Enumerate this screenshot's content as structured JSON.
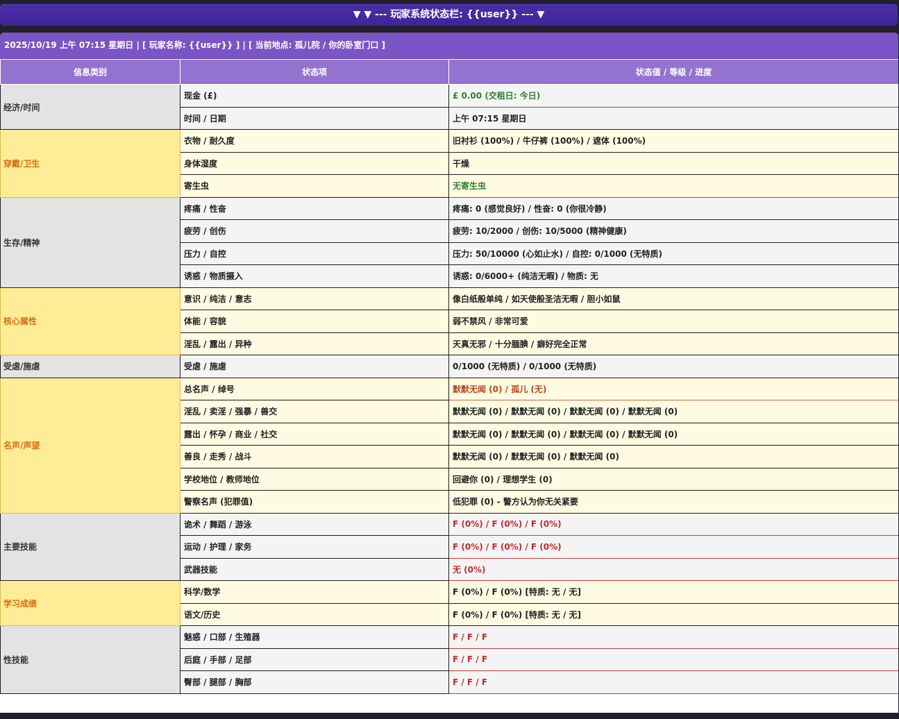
{
  "banner": {
    "prefix": "▼ ▼ --- 玩",
    "suffix": "家系统状态栏:  {{user}} --- ▼"
  },
  "infobar": {
    "text": "2025/10/19 上午 07:15 星期日 | [ 玩家名称:  {{user}} ] | [ 当前地点:  孤儿院 / 你的卧室门口 ]"
  },
  "table": {
    "headers": [
      "信息类别",
      "状态项",
      "状态值 / 等级 / 进度"
    ],
    "groups": [
      {
        "category": "经济/时间",
        "highlight": false,
        "rows": [
          {
            "item": "现金 (£)",
            "value": "£ 0.00 (交租日:  今日)",
            "tone": "green"
          },
          {
            "item": "时间 / 日期",
            "value": "上午 07:15 星期日",
            "tone": "normal"
          }
        ]
      },
      {
        "category": "穿戴/卫生",
        "highlight": true,
        "rows": [
          {
            "item": "衣物 / 耐久度",
            "value": "旧衬衫 (100%) / 牛仔裤 (100%) / 遮体 (100%)",
            "tone": "normal"
          },
          {
            "item": "身体湿度",
            "value": "干燥",
            "tone": "normal"
          },
          {
            "item": "寄生虫",
            "value": "无寄生虫",
            "tone": "green"
          }
        ]
      },
      {
        "category": "生存/精神",
        "highlight": false,
        "rows": [
          {
            "item": "疼痛 / 性奋",
            "value": "疼痛: 0 (感觉良好) / 性奋: 0 (你很冷静)",
            "tone": "normal"
          },
          {
            "item": "疲劳 / 创伤",
            "value": "疲劳: 10/2000 / 创伤: 10/5000 (精神健康)",
            "tone": "normal"
          },
          {
            "item": "压力 / 自控",
            "value": "压力: 50/10000 (心如止水) / 自控: 0/1000 (无特质)",
            "tone": "normal"
          },
          {
            "item": "诱惑 / 物质摄入",
            "value": "诱惑: 0/6000+ (纯洁无暇) / 物质: 无",
            "tone": "normal"
          }
        ]
      },
      {
        "category": "核心属性",
        "highlight": true,
        "rows": [
          {
            "item": "意识 / 纯洁 / 意志",
            "value": "像白纸般单纯 / 如天使般圣洁无暇 / 胆小如鼠",
            "tone": "normal"
          },
          {
            "item": "体能 / 容貌",
            "value": "弱不禁风 / 非常可爱",
            "tone": "normal"
          },
          {
            "item": "淫乱 / 露出 / 异种",
            "value": "天真无邪 / 十分腼腆 / 癖好完全正常",
            "tone": "normal"
          }
        ]
      },
      {
        "category": "受虐/施虐",
        "highlight": false,
        "rows": [
          {
            "item": "受虐 / 施虐",
            "value": "0/1000 (无特质) / 0/1000 (无特质)",
            "tone": "normal"
          }
        ]
      },
      {
        "category": "名声/声望",
        "highlight": true,
        "rows": [
          {
            "item": "总名声 / 绰号",
            "value": "默默无闻 (0) / 孤儿 (无)",
            "tone": "brown"
          },
          {
            "item": "淫乱 / 卖淫 / 强暴 / 兽交",
            "value": "默默无闻 (0) / 默默无闻 (0) / 默默无闻 (0) / 默默无闻 (0)",
            "tone": "normal"
          },
          {
            "item": "露出 / 怀孕 / 商业 / 社交",
            "value": "默默无闻 (0) / 默默无闻 (0) / 默默无闻 (0) / 默默无闻 (0)",
            "tone": "normal"
          },
          {
            "item": "善良 / 走秀 / 战斗",
            "value": "默默无闻 (0) / 默默无闻 (0) / 默默无闻 (0)",
            "tone": "normal"
          },
          {
            "item": "学校地位 / 教师地位",
            "value": "回避你 (0) / 理想学生 (0)",
            "tone": "normal"
          },
          {
            "item": "警察名声 (犯罪值)",
            "value": "低犯罪 (0) - 警方认为你无关紧要",
            "tone": "normal"
          }
        ]
      },
      {
        "category": "主要技能",
        "highlight": false,
        "rows": [
          {
            "item": "诡术 / 舞蹈 / 游泳",
            "value": "F (0%) / F (0%) / F (0%)",
            "tone": "red"
          },
          {
            "item": "运动 / 护理 / 家务",
            "value": "F (0%) / F (0%) / F (0%)",
            "tone": "red"
          },
          {
            "item": "武器技能",
            "value": "无 (0%)",
            "tone": "red"
          }
        ]
      },
      {
        "category": "学习成绩",
        "highlight": true,
        "rows": [
          {
            "item": "科学/数学",
            "value": "F (0%) / F (0%) [特质: 无 / 无]",
            "tone": "normal"
          },
          {
            "item": "语文/历史",
            "value": "F (0%) / F (0%) [特质: 无 / 无]",
            "tone": "normal"
          }
        ]
      },
      {
        "category": "性技能",
        "highlight": false,
        "rows": [
          {
            "item": "魅惑 / 口部 / 生殖器",
            "value": "F / F / F",
            "tone": "red"
          },
          {
            "item": "后庭 / 手部 / 足部",
            "value": "F / F / F",
            "tone": "red"
          },
          {
            "item": "臀部 / 腿部 / 胸部",
            "value": "F / F / F",
            "tone": "red"
          }
        ]
      }
    ]
  },
  "colors": {
    "banner": "#412699",
    "infobar": "#7b54c5",
    "header": "#9373cf",
    "category_yellow": "#ffec97",
    "category_yellow_text": "#d76f14",
    "green": "#2f7f2f",
    "red": "#c8282c",
    "brown": "#b8481a"
  }
}
